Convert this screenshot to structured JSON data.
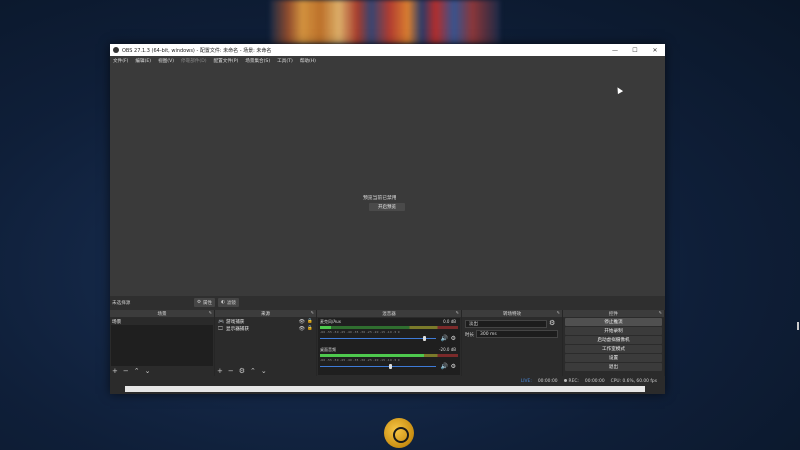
{
  "window": {
    "title": "OBS 27.1.3 (64-bit, windows) - 配置文件: 未命名 - 场景: 未命名",
    "minimize": "—",
    "maximize": "☐",
    "close": "✕"
  },
  "menu": {
    "file": "文件(F)",
    "edit": "编辑(E)",
    "view": "视图(V)",
    "docks": "停靠部件(D)",
    "profile": "配置文件(P)",
    "scene_collection": "场景集合(S)",
    "tools": "工具(T)",
    "help": "帮助(H)"
  },
  "preview": {
    "disabled_msg": "预览当前已禁用",
    "enable_button": "开启预览"
  },
  "status_row": {
    "no_source": "未选择源",
    "properties_button": "属性",
    "filters_button": "滤镜"
  },
  "scenes": {
    "title": "场景",
    "items": [
      "场景"
    ]
  },
  "sources": {
    "title": "来源",
    "items": [
      {
        "icon": "game-icon",
        "label": "游戏捕获"
      },
      {
        "icon": "monitor-icon",
        "label": "显示器捕获"
      }
    ]
  },
  "mixer": {
    "title": "混音器",
    "channels": [
      {
        "name": "麦克风/Aux",
        "db": "0.0 dB",
        "level": 0.08,
        "volume": 0.9
      },
      {
        "name": "桌面音频",
        "db": "-20.0 dB",
        "level": 0.75,
        "volume": 0.6
      }
    ],
    "scale": "-60 -55 -50 -45 -40 -35 -30 -25 -20 -15 -10 -5 0"
  },
  "transitions": {
    "title": "转场特效",
    "type": "淡出",
    "duration_label": "时长",
    "duration_value": "300 ms"
  },
  "controls": {
    "title": "控件",
    "buttons": [
      "停止推流",
      "开始录制",
      "启动虚拟摄像机",
      "工作室模式",
      "设置",
      "退出"
    ]
  },
  "bottom_status": {
    "live": "LIVE:",
    "live_time": "00:00:00",
    "rec": "REC:",
    "rec_time": "00:00:00",
    "cpu": "CPU: 0.6%, 60.00 fps"
  },
  "colors": {
    "window_bg": "#2b2b2b",
    "preview_bg": "#3a3a3a",
    "meter_green": "#4ec94e",
    "slider_blue": "#3e7ad6"
  }
}
